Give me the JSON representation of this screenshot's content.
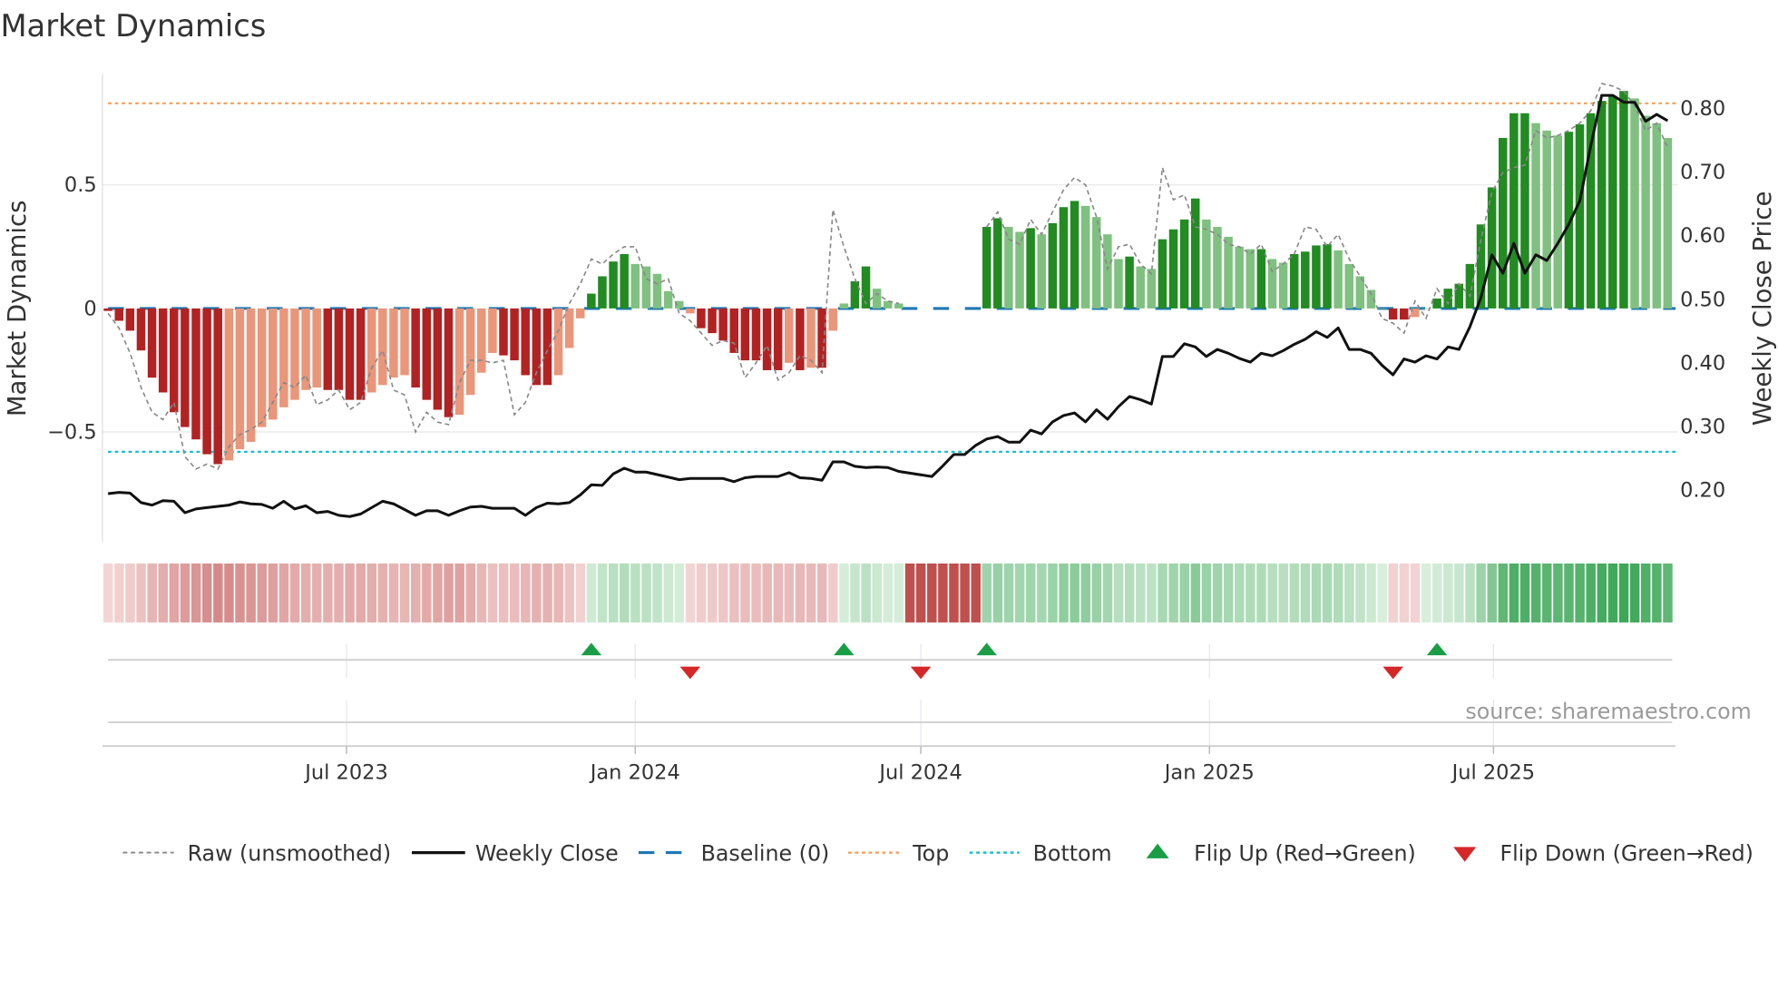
{
  "title": "Market Dynamics",
  "source": "source: sharemaestro.com",
  "axes": {
    "left_label": "Market Dynamics",
    "right_label": "Weekly Close Price"
  },
  "legend": [
    {
      "label": "Raw (unsmoothed)",
      "kind": "raw"
    },
    {
      "label": "Weekly Close",
      "kind": "close"
    },
    {
      "label": "Baseline (0)",
      "kind": "baseline"
    },
    {
      "label": "Top",
      "kind": "top"
    },
    {
      "label": "Bottom",
      "kind": "bottom"
    },
    {
      "label": "Flip Up (Red→Green)",
      "kind": "flip_up"
    },
    {
      "label": "Flip Down (Green→Red)",
      "kind": "flip_down"
    }
  ],
  "colors": {
    "bar_neg_strong": "#b22222",
    "bar_neg_weak": "#e9967a",
    "bar_pos_strong": "#228b22",
    "bar_pos_weak": "#80c080",
    "raw": "#888888",
    "close": "#111111",
    "baseline": "#1f77b4",
    "top": "#f4a460",
    "bottom": "#17becf",
    "flip_up": "#1a9e45",
    "flip_down": "#d62728"
  },
  "chart_data": {
    "type": "bar",
    "title": "Market Dynamics",
    "xlabel": "",
    "ylabel": "Market Dynamics",
    "ylabel_right": "Weekly Close Price",
    "frequency": "weekly",
    "start_date": "2023-01-30",
    "ylim": [
      -0.945,
      0.95
    ],
    "ylim_right": [
      0.118,
      0.855
    ],
    "top": 0.83,
    "bottom": -0.58,
    "baseline": 0,
    "y_ticks_left": [
      {
        "value": 0.5,
        "label": "0.5"
      },
      {
        "value": 0,
        "label": "0"
      },
      {
        "value": -0.5,
        "label": "−0.5"
      }
    ],
    "y_ticks_right": [
      {
        "value": 0.8,
        "label": "0.80"
      },
      {
        "value": 0.7,
        "label": "0.70"
      },
      {
        "value": 0.6,
        "label": "0.60"
      },
      {
        "value": 0.5,
        "label": "0.50"
      },
      {
        "value": 0.4,
        "label": "0.40"
      },
      {
        "value": 0.3,
        "label": "0.30"
      },
      {
        "value": 0.2,
        "label": "0.20"
      }
    ],
    "x_ticks": [
      {
        "date": "2023-07-01",
        "label": "Jul 2023"
      },
      {
        "date": "2024-01-01",
        "label": "Jan 2024"
      },
      {
        "date": "2024-07-01",
        "label": "Jul 2024"
      },
      {
        "date": "2025-01-01",
        "label": "Jan 2025"
      },
      {
        "date": "2025-07-01",
        "label": "Jul 2025"
      }
    ],
    "momentum": [
      -0.01,
      -0.05,
      -0.09,
      -0.17,
      -0.28,
      -0.34,
      -0.42,
      -0.48,
      -0.53,
      -0.59,
      -0.63,
      -0.615,
      -0.57,
      -0.54,
      -0.48,
      -0.45,
      -0.4,
      -0.37,
      -0.33,
      -0.32,
      -0.33,
      -0.33,
      -0.37,
      -0.37,
      -0.34,
      -0.31,
      -0.28,
      -0.27,
      -0.32,
      -0.37,
      -0.41,
      -0.44,
      -0.43,
      -0.35,
      -0.26,
      -0.18,
      -0.19,
      -0.21,
      -0.27,
      -0.31,
      -0.31,
      -0.27,
      -0.16,
      -0.04,
      0.06,
      0.13,
      0.19,
      0.22,
      0.18,
      0.17,
      0.14,
      0.07,
      0.03,
      -0.02,
      -0.08,
      -0.1,
      -0.13,
      -0.18,
      -0.21,
      -0.21,
      -0.25,
      -0.25,
      -0.22,
      -0.25,
      -0.24,
      -0.24,
      -0.09,
      0.02,
      0.11,
      0.17,
      0.08,
      0.03,
      0.02,
      null,
      null,
      null,
      null,
      null,
      null,
      null,
      0.33,
      0.365,
      0.33,
      0.31,
      0.325,
      0.3,
      0.345,
      0.41,
      0.435,
      0.415,
      0.37,
      0.3,
      0.2,
      0.21,
      0.17,
      0.16,
      0.28,
      0.32,
      0.36,
      0.445,
      0.36,
      0.33,
      0.29,
      0.25,
      0.24,
      0.24,
      0.2,
      0.185,
      0.22,
      0.23,
      0.255,
      0.26,
      0.235,
      0.18,
      0.13,
      0.075,
      0,
      -0.045,
      -0.045,
      -0.035,
      0,
      0.04,
      0.08,
      0.1,
      0.18,
      0.34,
      0.49,
      0.69,
      0.79,
      0.79,
      0.75,
      0.72,
      0.7,
      0.715,
      0.745,
      0.79,
      0.84,
      0.86,
      0.88,
      0.85,
      0.78,
      0.75,
      0.69
    ],
    "raw": [
      -0.02,
      -0.08,
      -0.18,
      -0.32,
      -0.42,
      -0.45,
      -0.38,
      -0.6,
      -0.65,
      -0.63,
      -0.65,
      -0.56,
      -0.51,
      -0.49,
      -0.46,
      -0.38,
      -0.3,
      -0.32,
      -0.27,
      -0.39,
      -0.37,
      -0.33,
      -0.41,
      -0.38,
      -0.24,
      -0.17,
      -0.33,
      -0.35,
      -0.5,
      -0.42,
      -0.46,
      -0.47,
      -0.3,
      -0.21,
      -0.21,
      -0.22,
      -0.21,
      -0.43,
      -0.38,
      -0.26,
      -0.17,
      -0.09,
      0.02,
      0.1,
      0.2,
      0.18,
      0.22,
      0.25,
      0.25,
      0.12,
      0.1,
      0.12,
      -0.02,
      -0.05,
      -0.1,
      -0.15,
      -0.13,
      -0.14,
      -0.28,
      -0.22,
      -0.15,
      -0.29,
      -0.26,
      -0.19,
      -0.21,
      -0.26,
      0.4,
      0.25,
      0.12,
      0.02,
      0.06,
      0.03,
      0.02,
      null,
      null,
      null,
      null,
      null,
      null,
      null,
      0.33,
      0.39,
      0.28,
      0.26,
      0.36,
      0.3,
      0.39,
      0.48,
      0.53,
      0.5,
      0.37,
      0.16,
      0.25,
      0.26,
      0.18,
      0.14,
      0.57,
      0.44,
      0.46,
      0.33,
      0.32,
      0.3,
      0.26,
      0.25,
      0.22,
      0.26,
      0.15,
      0.18,
      0.22,
      0.33,
      0.32,
      0.25,
      0.3,
      0.2,
      0.13,
      0.06,
      -0.04,
      -0.06,
      -0.1,
      0.03,
      -0.04,
      0.08,
      0.02,
      0.1,
      0.05,
      0.28,
      0.47,
      0.55,
      0.57,
      0.58,
      0.72,
      0.69,
      0.7,
      0.72,
      0.75,
      0.8,
      0.91,
      0.9,
      0.88,
      0.82,
      0.72,
      0.75,
      0.65
    ],
    "weekly_close": [
      0.194,
      0.196,
      0.195,
      0.18,
      0.176,
      0.183,
      0.182,
      0.164,
      0.17,
      0.172,
      0.174,
      0.176,
      0.181,
      0.178,
      0.177,
      0.171,
      0.182,
      0.17,
      0.175,
      0.164,
      0.166,
      0.16,
      0.158,
      0.162,
      0.172,
      0.182,
      0.178,
      0.169,
      0.16,
      0.167,
      0.167,
      0.16,
      0.167,
      0.173,
      0.174,
      0.171,
      0.171,
      0.171,
      0.16,
      0.172,
      0.179,
      0.178,
      0.18,
      0.192,
      0.208,
      0.207,
      0.225,
      0.234,
      0.228,
      0.228,
      0.224,
      0.22,
      0.216,
      0.218,
      0.218,
      0.218,
      0.218,
      0.213,
      0.219,
      0.221,
      0.221,
      0.221,
      0.227,
      0.219,
      0.218,
      0.215,
      0.244,
      0.244,
      0.237,
      0.235,
      0.236,
      0.235,
      0.229,
      null,
      null,
      0.221,
      0.2375,
      0.2555,
      0.2555,
      0.27,
      0.28,
      0.284,
      0.275,
      0.275,
      0.294,
      0.288,
      0.307,
      0.317,
      0.321,
      0.307,
      0.326,
      0.311,
      0.331,
      0.347,
      0.342,
      0.335,
      0.41,
      0.41,
      0.43,
      0.425,
      0.41,
      0.421,
      0.415,
      0.407,
      0.401,
      0.415,
      0.411,
      0.419,
      0.429,
      0.437,
      0.449,
      0.44,
      0.455,
      0.421,
      0.421,
      0.415,
      0.396,
      0.381,
      0.406,
      0.401,
      0.411,
      0.406,
      0.425,
      0.421,
      0.457,
      0.503,
      0.57,
      0.541,
      0.588,
      0.541,
      0.57,
      0.561,
      0.588,
      0.618,
      0.655,
      0.741,
      0.821,
      0.821,
      0.81,
      0.81,
      0.78,
      0.791,
      0.781
    ],
    "flip_up_weeks": [
      44,
      67,
      80,
      121
    ],
    "flip_down_weeks": [
      53,
      74,
      117
    ]
  }
}
